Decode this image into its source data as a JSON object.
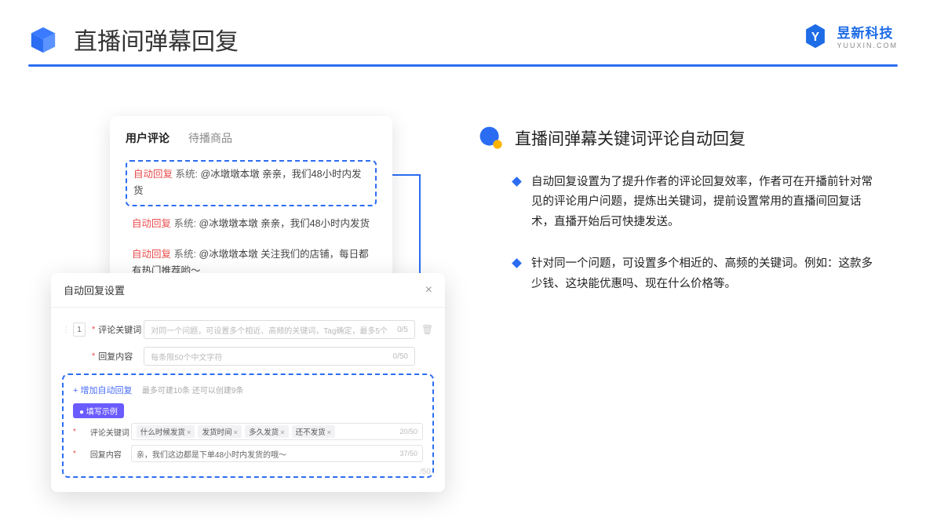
{
  "header": {
    "title": "直播间弹幕回复"
  },
  "brand": {
    "name": "昱新科技",
    "url": "YUUXIN.COM"
  },
  "comments": {
    "tab_active": "用户评论",
    "tab_other": "待播商品",
    "rows": [
      {
        "tag": "自动回复",
        "sys": "系统:",
        "text": "@冰墩墩本墩 亲亲，我们48小时内发货"
      },
      {
        "tag": "自动回复",
        "sys": "系统:",
        "text": "@冰墩墩本墩 亲亲，我们48小时内发货"
      },
      {
        "tag": "自动回复",
        "sys": "系统:",
        "text": "@冰墩墩本墩 关注我们的店铺，每日都有热门推荐哟～"
      }
    ]
  },
  "modal": {
    "title": "自动回复设置",
    "row_num": "1",
    "kw_label": "评论关键词",
    "kw_ph": "对同一个问题，可设置多个相近、高频的关键词，Tag确定，最多5个",
    "kw_cnt": "0/5",
    "content_label": "回复内容",
    "content_ph": "每条限50个中文字符",
    "content_cnt": "0/50",
    "add_link": "+ 增加自动回复",
    "add_hint": "最多可建10条 还可以创建9条",
    "example_badge": "● 填写示例",
    "ex_kw_label": "评论关键词",
    "ex_kw_tags": [
      "什么时候发货",
      "发货时间",
      "多久发货",
      "还不发货"
    ],
    "ex_kw_cnt": "20/50",
    "ex_ct_label": "回复内容",
    "ex_ct_text": "亲，我们这边都是下单48小时内发货的哦～",
    "ex_ct_cnt": "37/50",
    "side_cnt": "/50"
  },
  "right": {
    "title": "直播间弹幕关键词评论自动回复",
    "bullets": [
      "自动回复设置为了提升作者的评论回复效率，作者可在开播前针对常见的评论用户问题，提炼出关键词，提前设置常用的直播间回复话术，直播开始后可快捷发送。",
      "针对同一个问题，可设置多个相近的、高频的关键词。例如：这款多少钱、这块能优惠吗、现在什么价格等。"
    ]
  }
}
